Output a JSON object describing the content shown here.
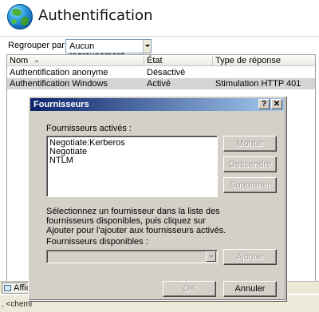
{
  "page": {
    "title": "Authentification"
  },
  "groupbar": {
    "label": "Regrouper par :",
    "value": "Aucun regroupement"
  },
  "grid": {
    "columns": [
      "Nom",
      "État",
      "Type de réponse"
    ],
    "rows": [
      {
        "name": "Authentification anonyme",
        "state": "Désactivé",
        "response": ""
      },
      {
        "name": "Authentification Windows",
        "state": "Activé",
        "response": "Stimulation HTTP 401"
      }
    ]
  },
  "bottombar": {
    "tab_label": "Affic"
  },
  "statusbar": {
    "text": ", <chemi"
  },
  "dialog": {
    "title": "Fournisseurs",
    "help_button": "?",
    "close_button": "✕",
    "enabled_label": "Fournisseurs activés :",
    "providers": [
      "Negotiate:Kerberos",
      "Negotiate",
      "NTLM"
    ],
    "move_up": "Monter",
    "move_down": "Descendre",
    "remove": "Supprimer",
    "instructions": "Sélectionnez un fournisseur dans la liste des fournisseurs disponibles, puis cliquez sur Ajouter pour l'ajouter aux fournisseurs activés.",
    "available_label": "Fournisseurs disponibles :",
    "add": "Ajouter",
    "ok": "OK",
    "cancel": "Annuler"
  }
}
